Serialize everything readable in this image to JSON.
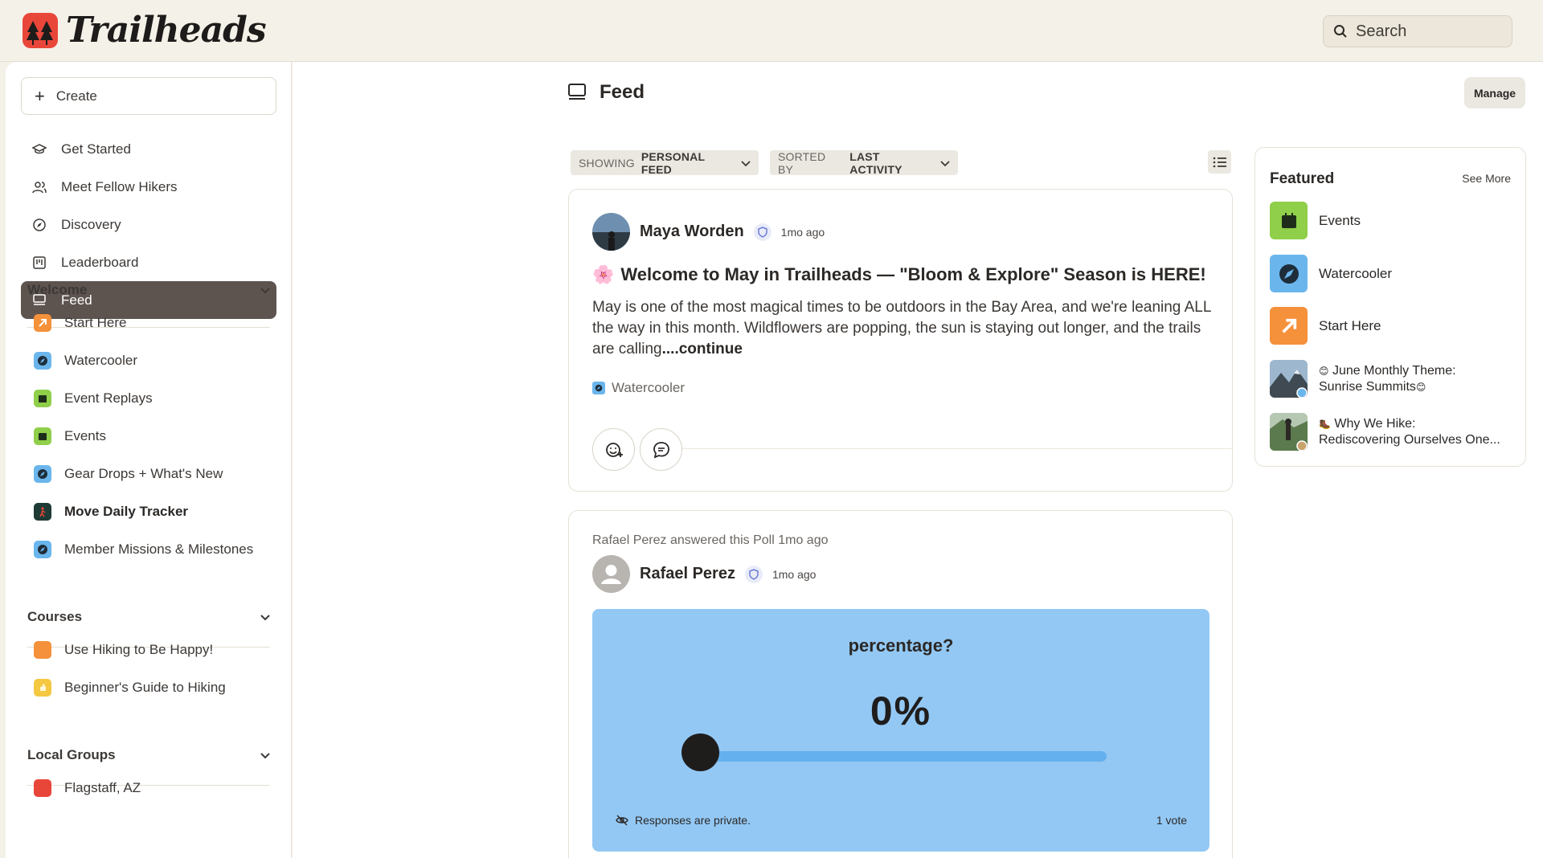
{
  "app": {
    "name": "Trailheads"
  },
  "search": {
    "placeholder": "Search"
  },
  "sidebar": {
    "create_label": "Create",
    "nav": [
      {
        "label": "Get Started",
        "icon": "graduation-cap-icon"
      },
      {
        "label": "Meet Fellow Hikers",
        "icon": "users-icon"
      },
      {
        "label": "Discovery",
        "icon": "compass-icon"
      },
      {
        "label": "Leaderboard",
        "icon": "leaderboard-icon"
      },
      {
        "label": "Feed",
        "icon": "feed-icon",
        "active": true
      }
    ],
    "sections": {
      "welcome": {
        "title": "Welcome",
        "items": [
          {
            "label": "Start Here",
            "color": "#f5913b",
            "icon": "arrow-up-right-icon"
          },
          {
            "label": "Watercooler",
            "color": "#6ab6ec",
            "icon": "compass-icon"
          },
          {
            "label": "Event Replays",
            "color": "#8fcf4a",
            "icon": "calendar-icon"
          },
          {
            "label": "Events",
            "color": "#8fcf4a",
            "icon": "calendar-icon"
          },
          {
            "label": "Gear Drops + What's New",
            "color": "#6ab6ec",
            "icon": "compass-icon"
          },
          {
            "label": "Move Daily Tracker",
            "color": "#1f3b35",
            "icon": "hiker-icon"
          },
          {
            "label": "Member Missions & Milestones",
            "color": "#6ab6ec",
            "icon": "compass-icon"
          }
        ]
      },
      "courses": {
        "title": "Courses",
        "items": [
          {
            "label": "Use Hiking to Be Happy!",
            "color": "#f5913b"
          },
          {
            "label": "Beginner's Guide to Hiking",
            "color": "#f5c842"
          }
        ]
      },
      "local_groups": {
        "title": "Local Groups",
        "items": [
          {
            "label": "Flagstaff, AZ",
            "color": "#e9463a"
          }
        ]
      }
    }
  },
  "main": {
    "title": "Feed",
    "manage_label": "Manage",
    "filters": {
      "showing_prefix": "SHOWING",
      "showing_value": "PERSONAL FEED",
      "sorted_prefix": "SORTED BY",
      "sorted_value": "LAST ACTIVITY"
    },
    "posts": [
      {
        "author": "Maya Worden",
        "time": "1mo ago",
        "emoji": "🌸",
        "title": "Welcome to May in Trailheads — \"Bloom & Explore\" Season is HERE!",
        "body": "May is one of the most magical times to be outdoors in the Bay Area, and we're leaning ALL the way in this month. Wildflowers are popping, the sun is staying out longer, and the trails are calling",
        "more": "....continue",
        "tag": "Watercooler"
      },
      {
        "activity": "Rafael Perez answered this Poll 1mo ago",
        "author": "Rafael Perez",
        "time": "1mo ago",
        "poll": {
          "question": "percentage?",
          "value_text": "0%",
          "value": 0,
          "private_label": "Responses are private.",
          "votes": "1 vote"
        }
      }
    ]
  },
  "featured": {
    "title": "Featured",
    "see_more": "See More",
    "items": [
      {
        "label": "Events",
        "color": "#8fcf4a",
        "icon": "calendar-icon"
      },
      {
        "label": "Watercooler",
        "color": "#6ab6ec",
        "icon": "compass-icon"
      },
      {
        "label": "Start Here",
        "color": "#f5913b",
        "icon": "arrow-up-right-icon"
      },
      {
        "line1": "June Monthly Theme:",
        "line2": "Sunrise Summits",
        "emoji": "😊"
      },
      {
        "line1": "Why We Hike:",
        "line2": "Rediscovering Ourselves One...",
        "emoji": "🥾"
      }
    ]
  }
}
